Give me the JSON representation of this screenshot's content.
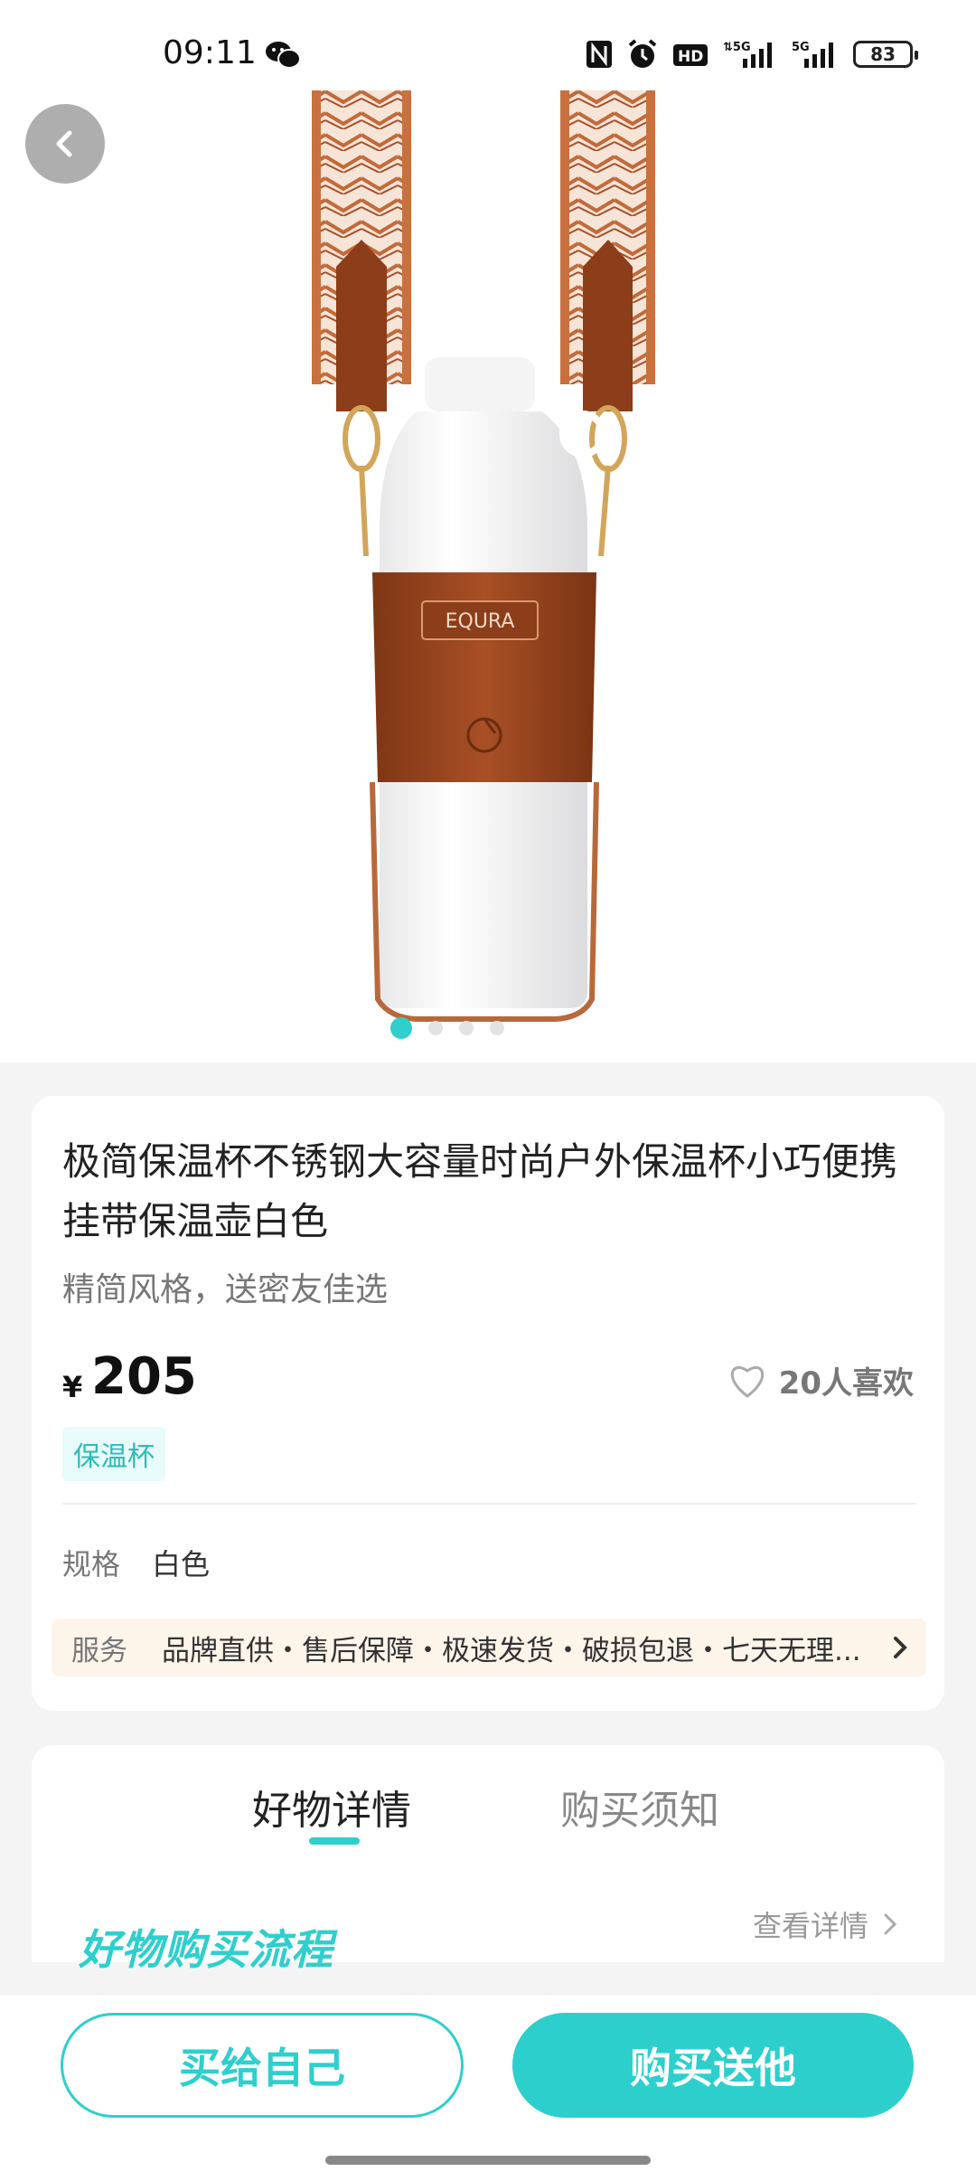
{
  "status_bar": {
    "time": "09:11",
    "battery": "83",
    "icons": [
      "wechat-icon",
      "nfc-icon",
      "alarm-icon",
      "hd-icon",
      "signal-5g-icon",
      "signal-5g-icon",
      "battery-icon"
    ]
  },
  "product": {
    "title": "极简保温杯不锈钢大容量时尚户外保温杯小巧便携挂带保温壶白色",
    "subtitle": "精简风格，送密友佳选",
    "currency": "¥",
    "price": "205",
    "likes": "20人喜欢",
    "tag": "保温杯",
    "image_brand_text": "EQURA",
    "carousel_count": 4,
    "carousel_active": 1
  },
  "spec": {
    "label": "规格",
    "value": "白色"
  },
  "service": {
    "label": "服务",
    "text": "品牌直供・售后保障・极速发货・破损包退・七天无理..."
  },
  "tabs": [
    {
      "label": "好物详情"
    },
    {
      "label": "购买须知"
    }
  ],
  "process": {
    "title": "好物购买流程",
    "view_more": "查看详情"
  },
  "actions": {
    "buy_self": "买给自己",
    "buy_gift": "购买送他"
  },
  "colors": {
    "accent": "#2ecfcc",
    "leather": "#9c4a22",
    "service_bg": "#fdf4ea"
  }
}
